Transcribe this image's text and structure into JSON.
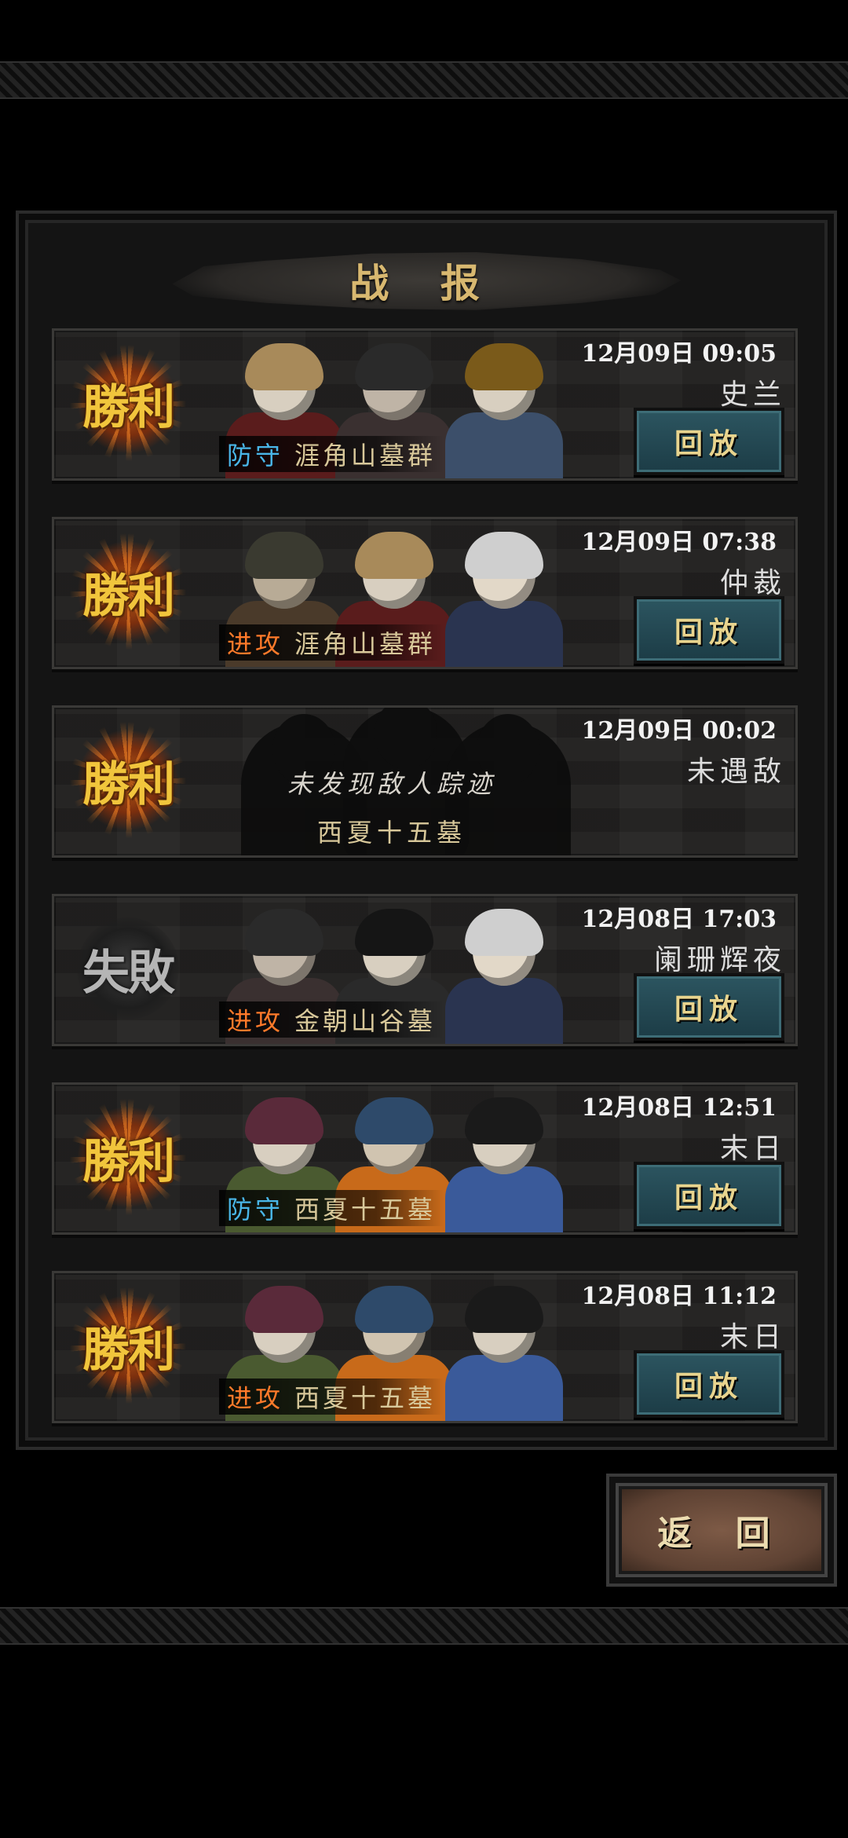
{
  "title": "战  报",
  "back_label": "返 回",
  "colors": {
    "defense": "#49b6e8",
    "attack": "#ff7a2a",
    "victory": "#f1c53c",
    "defeat": "#b5b5b5",
    "replay_button": "#2c5560"
  },
  "reports": [
    {
      "result": "勝利",
      "outcome": "victory",
      "time": "12月09日 09:05",
      "opponent": "史兰",
      "mode": "防守",
      "mode_type": "defense",
      "location": "涯角山墓群",
      "replay_label": "回放",
      "has_replay": true
    },
    {
      "result": "勝利",
      "outcome": "victory",
      "time": "12月09日 07:38",
      "opponent": "仲裁",
      "mode": "进攻",
      "mode_type": "attack",
      "location": "涯角山墓群",
      "replay_label": "回放",
      "has_replay": true
    },
    {
      "result": "勝利",
      "outcome": "victory",
      "time": "12月09日 00:02",
      "opponent": "未遇敌",
      "empty_message": "未发现敌人踪迹",
      "location": "西夏十五墓",
      "has_replay": false
    },
    {
      "result": "失敗",
      "outcome": "defeat",
      "time": "12月08日 17:03",
      "opponent": "阑珊辉夜",
      "mode": "进攻",
      "mode_type": "attack",
      "location": "金朝山谷墓",
      "replay_label": "回放",
      "has_replay": true
    },
    {
      "result": "勝利",
      "outcome": "victory",
      "time": "12月08日 12:51",
      "opponent": "末日",
      "mode": "防守",
      "mode_type": "defense",
      "location": "西夏十五墓",
      "replay_label": "回放",
      "has_replay": true
    },
    {
      "result": "勝利",
      "outcome": "victory",
      "time": "12月08日 11:12",
      "opponent": "末日",
      "mode": "进攻",
      "mode_type": "attack",
      "location": "西夏十五墓",
      "replay_label": "回放",
      "has_replay": true
    }
  ]
}
